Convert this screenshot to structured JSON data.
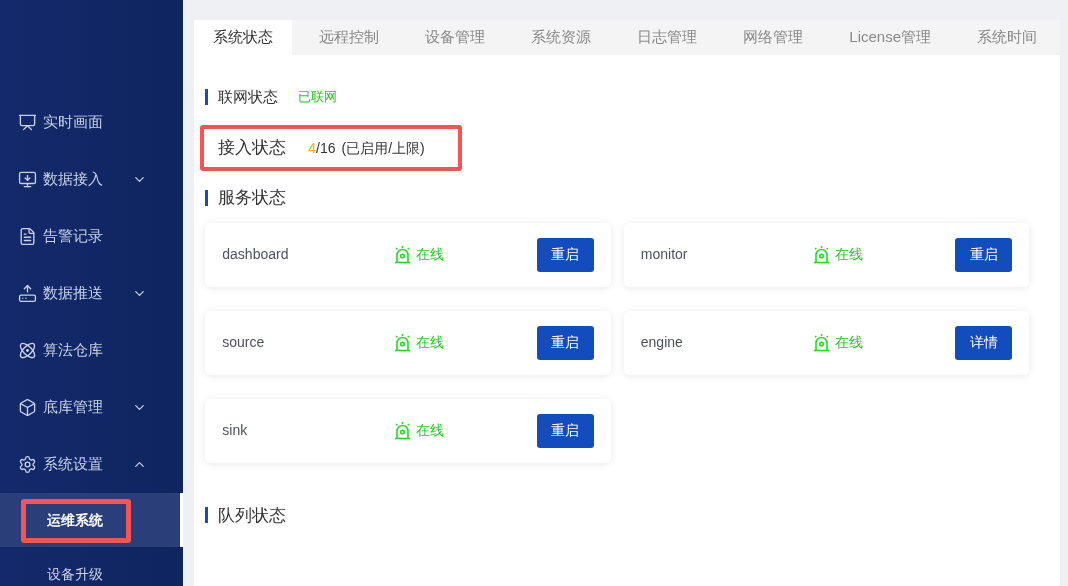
{
  "sidebar": {
    "items": [
      {
        "label": "实时画面"
      },
      {
        "label": "数据接入",
        "expanded": false
      },
      {
        "label": "告警记录"
      },
      {
        "label": "数据推送",
        "expanded": false
      },
      {
        "label": "算法仓库"
      },
      {
        "label": "底库管理",
        "expanded": false
      },
      {
        "label": "系统设置",
        "expanded": true,
        "children": [
          {
            "label": "运维系统",
            "selected": true,
            "highlighted": true
          },
          {
            "label": "设备升级",
            "selected": false,
            "highlighted": false
          }
        ]
      }
    ]
  },
  "tabs": [
    {
      "label": "系统状态",
      "selected": true
    },
    {
      "label": "远程控制",
      "selected": false
    },
    {
      "label": "设备管理",
      "selected": false
    },
    {
      "label": "系统资源",
      "selected": false
    },
    {
      "label": "日志管理",
      "selected": false
    },
    {
      "label": "网络管理",
      "selected": false
    },
    {
      "label": "License管理",
      "selected": false
    },
    {
      "label": "系统时间",
      "selected": false
    }
  ],
  "network": {
    "title": "联网状态",
    "status": "已联网"
  },
  "access": {
    "title": "接入状态",
    "used": "4",
    "limit": "/16",
    "note": "(已启用/上限)",
    "highlighted": true
  },
  "services": {
    "title": "服务状态",
    "items": [
      {
        "name": "dashboard",
        "status": "在线",
        "online": true,
        "action": "重启"
      },
      {
        "name": "monitor",
        "status": "在线",
        "online": true,
        "action": "重启"
      },
      {
        "name": "source",
        "status": "在线",
        "online": true,
        "action": "重启"
      },
      {
        "name": "engine",
        "status": "在线",
        "online": true,
        "action": "详情"
      },
      {
        "name": "sink",
        "status": "在线",
        "online": true,
        "action": "重启"
      }
    ]
  },
  "queue": {
    "title": "队列状态"
  }
}
